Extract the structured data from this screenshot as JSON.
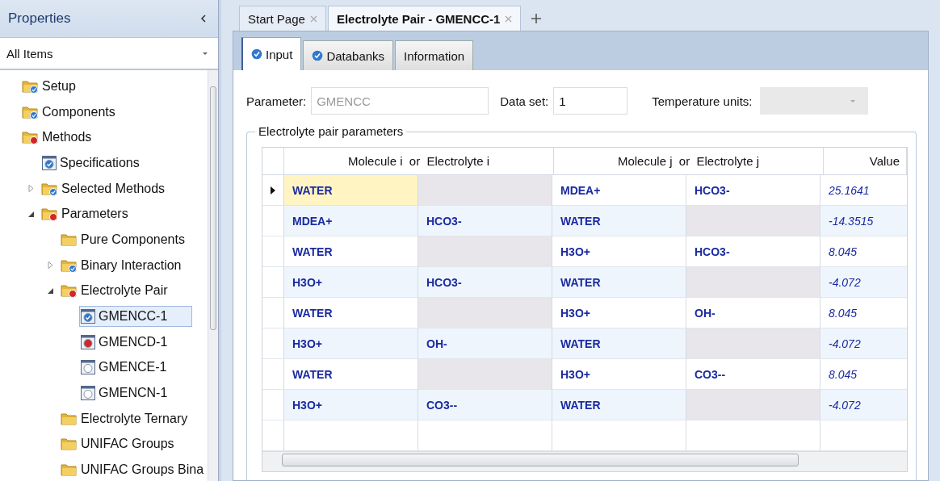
{
  "sidebar": {
    "title": "Properties",
    "filter": {
      "value": "All Items"
    },
    "items": [
      {
        "label": "Setup",
        "kind": "folder",
        "complete": true,
        "error": false,
        "selected": false
      },
      {
        "label": "Components",
        "kind": "folder",
        "complete": true,
        "error": false,
        "selected": false
      },
      {
        "label": "Methods",
        "kind": "folder",
        "complete": false,
        "error": true,
        "selected": false,
        "children": [
          {
            "label": "Specifications",
            "kind": "form",
            "complete": true,
            "error": false,
            "selected": false
          },
          {
            "label": "Selected Methods",
            "kind": "folder",
            "complete": true,
            "error": false,
            "selected": false,
            "expanded": false
          },
          {
            "label": "Parameters",
            "kind": "folder",
            "complete": false,
            "error": true,
            "selected": false,
            "expanded": true,
            "children": [
              {
                "label": "Pure Components",
                "kind": "folder",
                "complete": false,
                "error": false,
                "selected": false
              },
              {
                "label": "Binary Interaction",
                "kind": "folder",
                "complete": true,
                "error": false,
                "selected": false,
                "expanded": false
              },
              {
                "label": "Electrolyte Pair",
                "kind": "folder",
                "complete": false,
                "error": true,
                "selected": false,
                "expanded": true,
                "children": [
                  {
                    "label": "GMENCC-1",
                    "kind": "form",
                    "complete": true,
                    "error": false,
                    "selected": true
                  },
                  {
                    "label": "GMENCD-1",
                    "kind": "form",
                    "complete": false,
                    "error": true,
                    "selected": false
                  },
                  {
                    "label": "GMENCE-1",
                    "kind": "form",
                    "complete": false,
                    "error": false,
                    "selected": false
                  },
                  {
                    "label": "GMENCN-1",
                    "kind": "form",
                    "complete": false,
                    "error": false,
                    "selected": false
                  }
                ]
              },
              {
                "label": "Electrolyte Ternary",
                "kind": "folder",
                "complete": false,
                "error": false,
                "selected": false
              },
              {
                "label": "UNIFAC Groups",
                "kind": "folder",
                "complete": false,
                "error": false,
                "selected": false
              },
              {
                "label": "UNIFAC Groups Bina",
                "kind": "folder",
                "complete": false,
                "error": false,
                "selected": false
              }
            ]
          }
        ]
      }
    ]
  },
  "doc_tabs": [
    {
      "label": "Start Page",
      "selected": false
    },
    {
      "label": "Electrolyte Pair - GMENCC-1",
      "selected": true
    }
  ],
  "form_tabs": [
    {
      "label": "Input",
      "complete": true,
      "selected": true
    },
    {
      "label": "Databanks",
      "complete": true,
      "selected": false
    },
    {
      "label": "Information",
      "complete": false,
      "selected": false
    }
  ],
  "fields": {
    "parameter": {
      "label": "Parameter:",
      "value": "GMENCC",
      "disabled": true
    },
    "data_set": {
      "label": "Data set:",
      "value": "1",
      "disabled": false
    },
    "temperature_units": {
      "label": "Temperature units:",
      "disabled": true
    }
  },
  "table": {
    "group_title": "Electrolyte pair parameters",
    "headers": [
      "Molecule i  or  Electrolyte i",
      "Molecule j  or  Electrolyte j",
      "Value"
    ],
    "rows": [
      {
        "selected": true,
        "cells": [
          "WATER",
          null,
          "MDEA+",
          "HCO3-"
        ],
        "value": "25.1641"
      },
      {
        "selected": false,
        "cells": [
          "MDEA+",
          "HCO3-",
          "WATER",
          null
        ],
        "value": "-14.3515"
      },
      {
        "selected": false,
        "cells": [
          "WATER",
          null,
          "H3O+",
          "HCO3-"
        ],
        "value": "8.045"
      },
      {
        "selected": false,
        "cells": [
          "H3O+",
          "HCO3-",
          "WATER",
          null
        ],
        "value": "-4.072"
      },
      {
        "selected": false,
        "cells": [
          "WATER",
          null,
          "H3O+",
          "OH-"
        ],
        "value": "8.045"
      },
      {
        "selected": false,
        "cells": [
          "H3O+",
          "OH-",
          "WATER",
          null
        ],
        "value": "-4.072"
      },
      {
        "selected": false,
        "cells": [
          "WATER",
          null,
          "H3O+",
          "CO3--"
        ],
        "value": "8.045"
      },
      {
        "selected": false,
        "cells": [
          "H3O+",
          "CO3--",
          "WATER",
          null
        ],
        "value": "-4.072"
      }
    ]
  }
}
